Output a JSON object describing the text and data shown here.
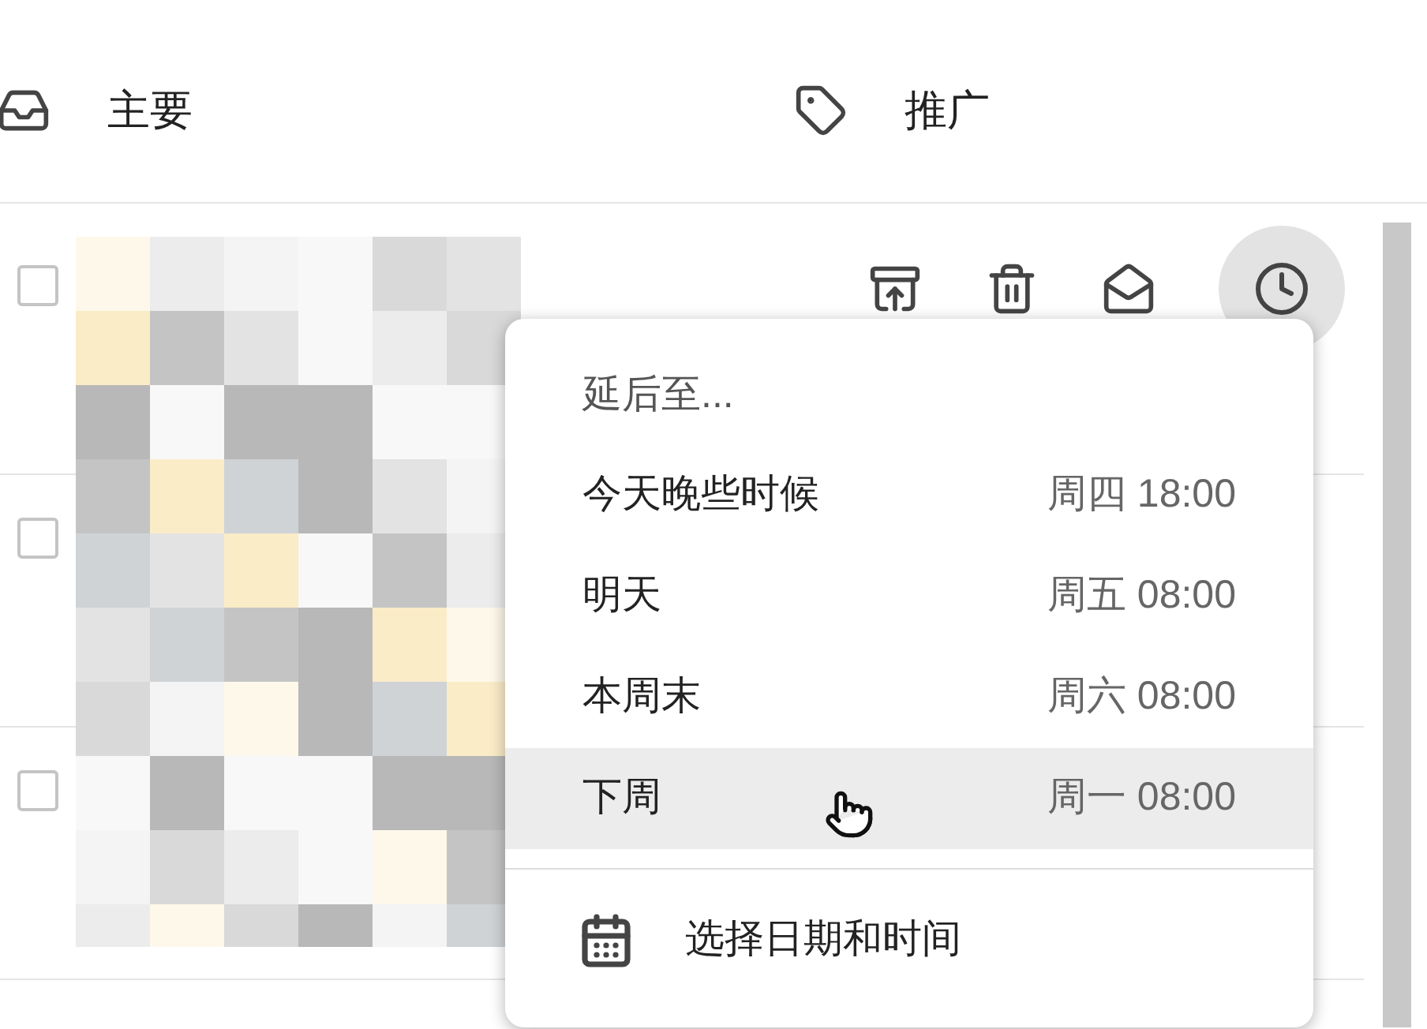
{
  "tabs": [
    {
      "label": "主要",
      "kind": "inbox"
    },
    {
      "label": "推广",
      "kind": "tag"
    }
  ],
  "rows": [
    {
      "checked": false,
      "hovered": true
    },
    {
      "checked": false,
      "hovered": false
    },
    {
      "checked": false,
      "hovered": false
    }
  ],
  "snooze_menu": {
    "title": "延后至...",
    "options": [
      {
        "label": "今天晚些时候",
        "time": "周四 18:00",
        "selected": false
      },
      {
        "label": "明天",
        "time": "周五 08:00",
        "selected": false
      },
      {
        "label": "本周末",
        "time": "周六 08:00",
        "selected": false
      },
      {
        "label": "下周",
        "time": "周一 08:00",
        "selected": true
      }
    ],
    "custom": "选择日期和时间"
  }
}
